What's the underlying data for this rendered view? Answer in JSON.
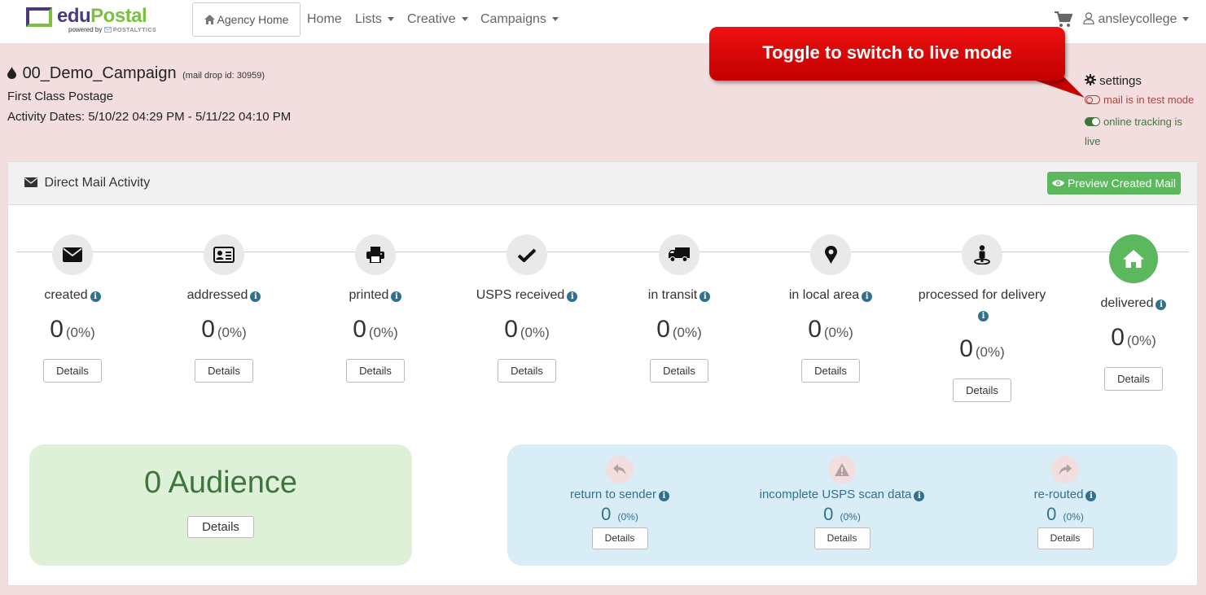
{
  "brand": {
    "name_part1": "edu",
    "name_part2": "Postal",
    "powered_by": "powered by",
    "partner": "POSTALYTICS",
    "primary_color": "#4a3a7d",
    "accent_color": "#7bc043"
  },
  "navbar": {
    "agency_home": "Agency Home",
    "links": [
      "Home",
      "Lists",
      "Creative",
      "Campaigns"
    ],
    "user": "ansleycollege"
  },
  "campaign": {
    "name": "00_Demo_Campaign",
    "mail_drop": "(mail drop id: 30959)",
    "postage": "First Class Postage",
    "activity_dates": "Activity Dates: 5/10/22 04:29 PM - 5/11/22 04:10 PM"
  },
  "callout": {
    "text": "Toggle to switch to live mode",
    "color": "#dd0000"
  },
  "settings": {
    "label": "settings",
    "test_mode": "mail is in test mode",
    "tracking": "online tracking is live"
  },
  "panel": {
    "title": "Direct Mail Activity",
    "preview_button": "Preview Created Mail",
    "details_label": "Details",
    "steps": [
      {
        "label": "created",
        "icon": "envelope-icon",
        "count": "0",
        "pct": "(0%)"
      },
      {
        "label": "addressed",
        "icon": "address-card-icon",
        "count": "0",
        "pct": "(0%)"
      },
      {
        "label": "printed",
        "icon": "printer-icon",
        "count": "0",
        "pct": "(0%)"
      },
      {
        "label": "USPS received",
        "icon": "checkmark-icon",
        "count": "0",
        "pct": "(0%)"
      },
      {
        "label": "in transit",
        "icon": "truck-icon",
        "count": "0",
        "pct": "(0%)"
      },
      {
        "label": "in local area",
        "icon": "map-marker-icon",
        "count": "0",
        "pct": "(0%)"
      },
      {
        "label": "processed for delivery",
        "icon": "street-view-icon",
        "count": "0",
        "pct": "(0%)"
      },
      {
        "label": "delivered",
        "icon": "home-icon",
        "count": "0",
        "pct": "(0%)"
      }
    ]
  },
  "audience": {
    "count": "0",
    "label": "Audience",
    "details": "Details"
  },
  "exceptions": [
    {
      "label": "return to sender",
      "icon": "reply-icon",
      "count": "0",
      "pct": "(0%)"
    },
    {
      "label": "incomplete USPS scan data",
      "icon": "warning-icon",
      "count": "0",
      "pct": "(0%)"
    },
    {
      "label": "re-routed",
      "icon": "share-icon",
      "count": "0",
      "pct": "(0%)"
    }
  ]
}
